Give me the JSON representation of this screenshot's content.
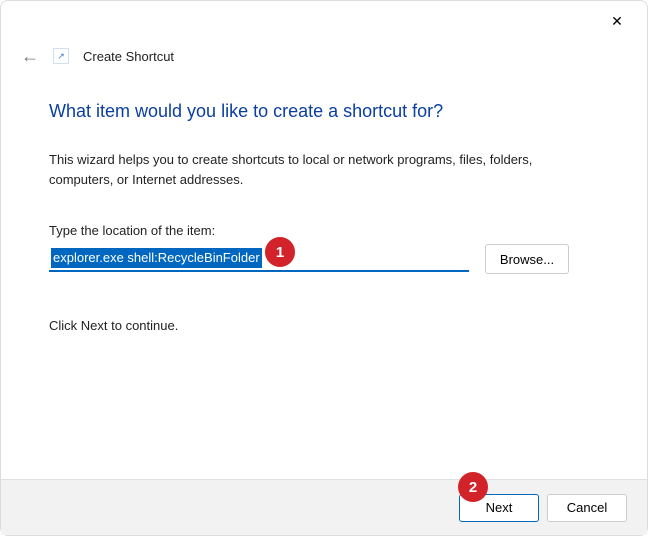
{
  "titlebar": {
    "close_glyph": "✕"
  },
  "header": {
    "back_glyph": "←",
    "title": "Create Shortcut"
  },
  "main": {
    "heading": "What item would you like to create a shortcut for?",
    "description": "This wizard helps you to create shortcuts to local or network programs, files, folders, computers, or Internet addresses.",
    "field_label": "Type the location of the item:",
    "location_value": "explorer.exe shell:RecycleBinFolder",
    "browse_label": "Browse...",
    "continue_text": "Click Next to continue."
  },
  "footer": {
    "next_label": "Next",
    "cancel_label": "Cancel"
  },
  "callouts": {
    "one": "1",
    "two": "2"
  }
}
